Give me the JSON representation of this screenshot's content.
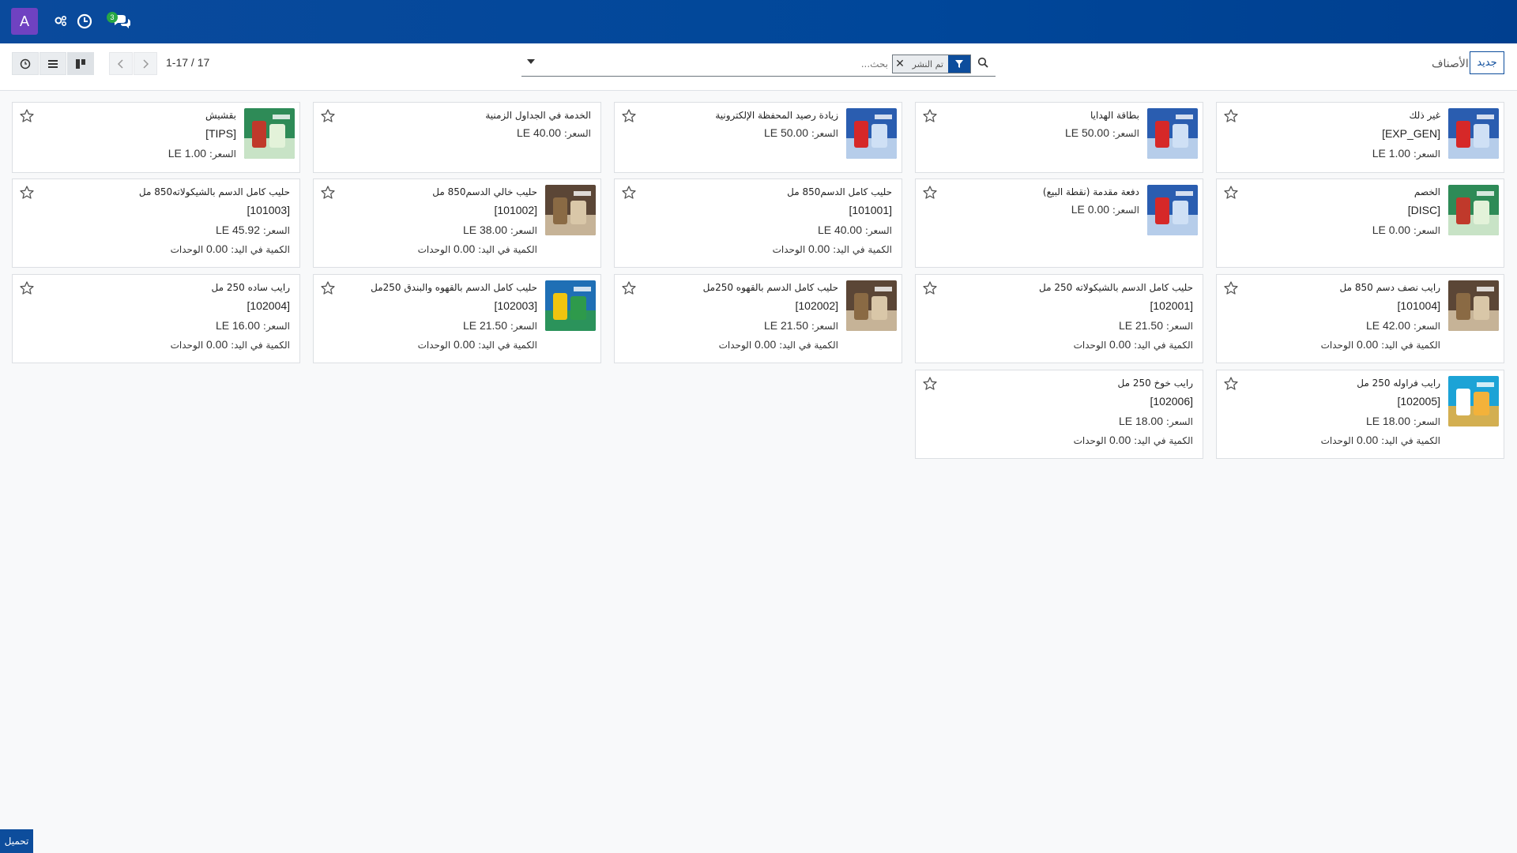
{
  "navbar": {
    "avatar_letter": "A",
    "messages_count": "3",
    "icons": [
      "settings-icon",
      "clock-icon",
      "chat-icon"
    ]
  },
  "control": {
    "pager": "1-17 / 17",
    "search_placeholder": "بحث...",
    "facet_label": "تم النشر",
    "breadcrumb": "الأصناف",
    "new_button": "جديد"
  },
  "labels": {
    "price": "السعر:",
    "qty": "الكمية في اليد:",
    "units": "الوحدات"
  },
  "products": [
    {
      "name": "غير ذلك",
      "code": "[EXP_GEN]",
      "price": "1.00 LE"
    },
    {
      "name": "بطاقة الهدايا",
      "code": "",
      "price": "50.00 LE"
    },
    {
      "name": "زيادة رصيد المحفظة الإلكترونية",
      "code": "",
      "price": "50.00 LE"
    },
    {
      "name": "الخدمة في الجداول الزمنية",
      "code": "",
      "price": "40.00 LE"
    },
    {
      "name": "بقشيش",
      "code": "[TIPS]",
      "price": "1.00 LE"
    },
    {
      "name": "الخصم",
      "code": "[DISC]",
      "price": "0.00 LE"
    },
    {
      "name": "دفعة مقدمة (نقطة البيع)",
      "code": "",
      "price": "0.00 LE"
    },
    {
      "name": "حليب كامل الدسم850 مل",
      "code": "[101001]",
      "price": "40.00 LE",
      "qty": "0.00"
    },
    {
      "name": "حليب خالي الدسم850 مل",
      "code": "[101002]",
      "price": "38.00 LE",
      "qty": "0.00"
    },
    {
      "name": "حليب كامل الدسم بالشيكولاته850 مل",
      "code": "[101003]",
      "price": "45.92 LE",
      "qty": "0.00"
    },
    {
      "name": "رايب نصف دسم 850 مل",
      "code": "[101004]",
      "price": "42.00 LE",
      "qty": "0.00"
    },
    {
      "name": "حليب كامل الدسم بالشيكولاته 250 مل",
      "code": "[102001]",
      "price": "21.50 LE",
      "qty": "0.00"
    },
    {
      "name": "حليب كامل الدسم بالقهوه 250مل",
      "code": "[102002]",
      "price": "21.50 LE",
      "qty": "0.00"
    },
    {
      "name": "حليب كامل الدسم بالقهوه والبندق 250مل",
      "code": "[102003]",
      "price": "21.50 LE",
      "qty": "0.00"
    },
    {
      "name": "رايب ساده 250 مل",
      "code": "[102004]",
      "price": "16.00 LE",
      "qty": "0.00"
    },
    {
      "name": "رايب فراوله 250 مل",
      "code": "[102005]",
      "price": "18.00 LE",
      "qty": "0.00"
    },
    {
      "name": "رايب خوخ 250 مل",
      "code": "[102006]",
      "price": "18.00 LE",
      "qty": "0.00"
    }
  ],
  "footer": {
    "download_label": "تحميل"
  }
}
